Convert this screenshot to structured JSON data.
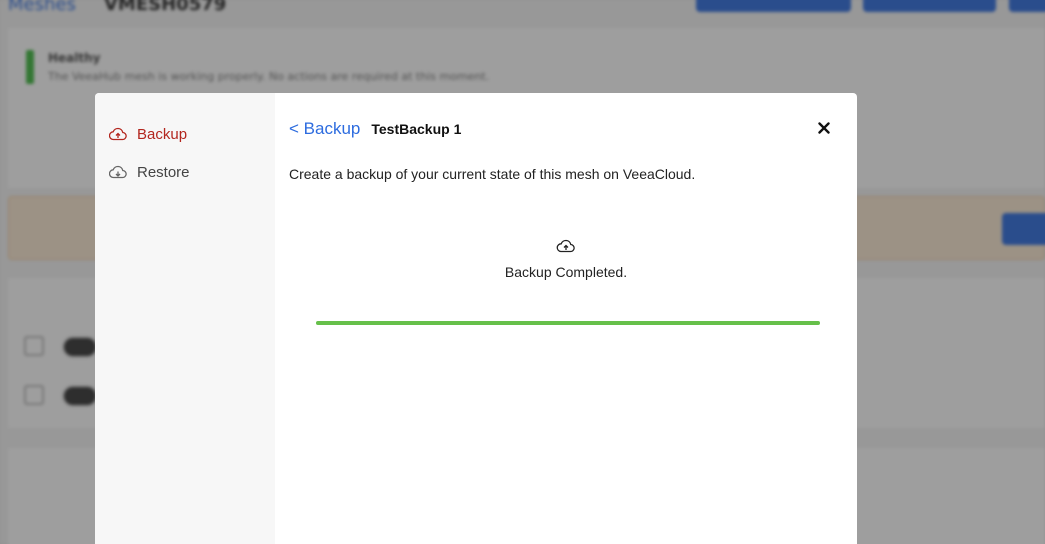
{
  "background": {
    "breadcrumb_parent": "Meshes",
    "breadcrumb_current": "VMESH0579",
    "health_title": "Healthy",
    "health_text": "The VeeaHub mesh is working properly. No actions are required at this moment."
  },
  "modal": {
    "sidebar": {
      "items": [
        {
          "label": "Backup",
          "icon": "cloud-upload-icon",
          "active": true
        },
        {
          "label": "Restore",
          "icon": "cloud-download-icon",
          "active": false
        }
      ]
    },
    "header": {
      "back_label": "< Backup",
      "title": "TestBackup 1",
      "close_icon": "close-icon"
    },
    "description": "Create a backup of your current state of this mesh on VeeaCloud.",
    "status": {
      "icon": "cloud-upload-icon",
      "text": "Backup Completed.",
      "progress_percent": 100
    },
    "colors": {
      "accent_active": "#b3261e",
      "link": "#2d6cdf",
      "progress": "#66c04a"
    }
  }
}
